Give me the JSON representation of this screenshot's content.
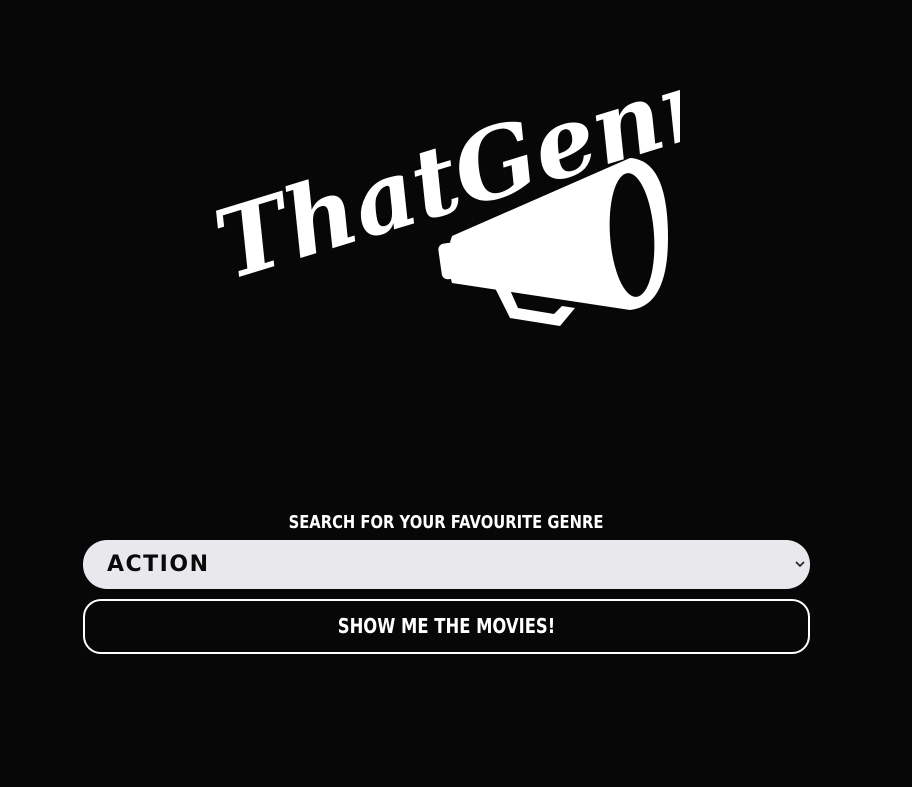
{
  "logo": {
    "wordmark": "ThatGenre",
    "icon": "megaphone-icon"
  },
  "search": {
    "label": "SEARCH FOR YOUR FAVOURITE GENRE",
    "selected_genre": "ACTION",
    "chevron_icon": "chevron-down-icon"
  },
  "actions": {
    "submit_label": "SHOW ME THE MOVIES!"
  },
  "colors": {
    "background": "#070707",
    "foreground": "#ffffff",
    "select_background": "#e8e8ed"
  }
}
